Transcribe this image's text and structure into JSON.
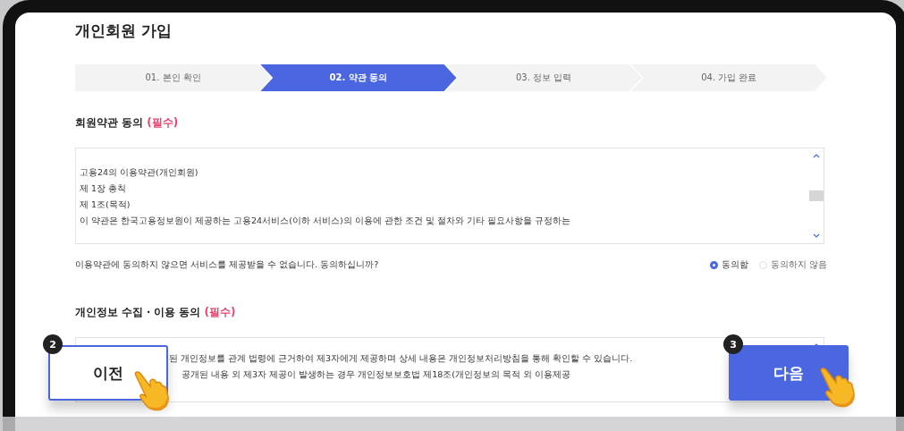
{
  "page": {
    "title": "개인회원 가입"
  },
  "steps": [
    {
      "label": "01. 본인 확인",
      "selected": false
    },
    {
      "label": "02. 약관 동의",
      "selected": true
    },
    {
      "label": "03. 정보 입력",
      "selected": false
    },
    {
      "label": "04. 가입 완료",
      "selected": false
    }
  ],
  "sections": [
    {
      "heading": "회원약관 동의",
      "required": "(필수)",
      "lines": [
        "고용24의 이용약관(개인회원)",
        "제 1장 총칙",
        "제 1조(목적)",
        "이 약관은 한국고용정보원이 제공하는 고용24서비스(이하 서비스)의 이용에 관한 조건 및 절차와 기타 필요사항을 규정하는"
      ],
      "notice": "이용약관에 동의하지 않으면 서비스를 제공받을 수 없습니다.  동의하십니까?",
      "options": [
        {
          "label": "동의함",
          "selected": true
        },
        {
          "label": "동의하지 않음",
          "selected": false
        }
      ]
    },
    {
      "heading": "개인정보 수집・이용 동의",
      "required": "(필수)",
      "lines": [
        "된 개인정보를 관계 법령에 근거하여 제3자에게 제공하며 상세 내용은 개인정보처리방침을 통해 확인할 수 있습니다.",
        "공개된 내용 외 제3자 제공이 발생하는 경우 개인정보보호법 제18조(개인정보의 목적 외 이용제공"
      ]
    }
  ],
  "callouts": [
    {
      "number": "2",
      "label": "이전",
      "kind": "secondary"
    },
    {
      "number": "3",
      "label": "다음",
      "kind": "primary"
    }
  ]
}
